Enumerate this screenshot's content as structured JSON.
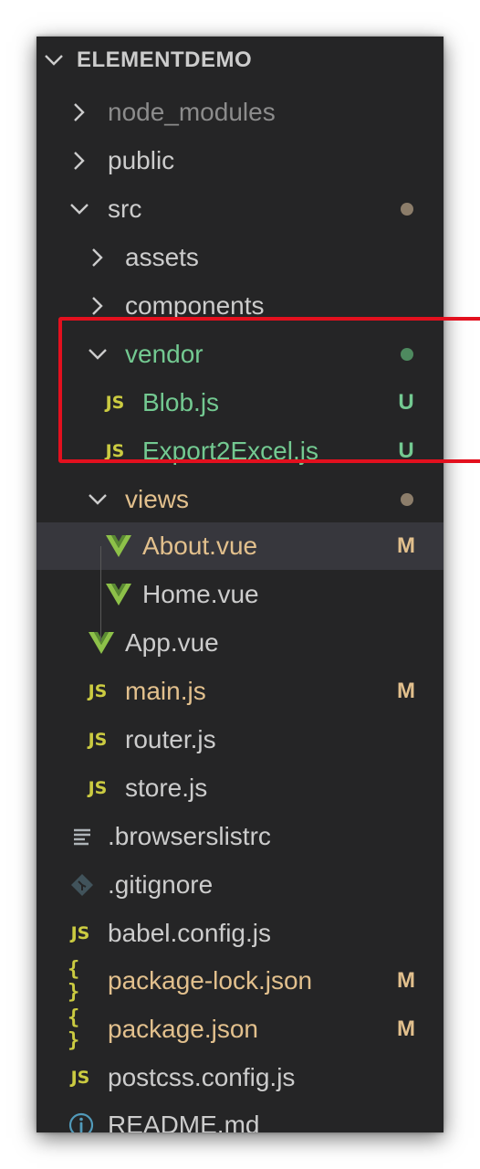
{
  "explorer": {
    "root_title": "ELEMENTDEMO",
    "items": [
      {
        "name": "node_modules",
        "kind": "folder",
        "state": "collapsed",
        "icon": "chevron-right-icon"
      },
      {
        "name": "public",
        "kind": "folder",
        "state": "collapsed",
        "icon": "chevron-right-icon"
      },
      {
        "name": "src",
        "kind": "folder",
        "state": "expanded",
        "icon": "chevron-down-icon"
      },
      {
        "name": "assets",
        "kind": "folder",
        "state": "collapsed",
        "icon": "chevron-right-icon"
      },
      {
        "name": "components",
        "kind": "folder",
        "state": "collapsed",
        "icon": "chevron-right-icon"
      },
      {
        "name": "vendor",
        "kind": "folder",
        "state": "expanded",
        "icon": "chevron-down-icon"
      },
      {
        "name": "Blob.js",
        "kind": "file",
        "icon": "js-icon",
        "icon_text": "JS",
        "badge": "U"
      },
      {
        "name": "Export2Excel.js",
        "kind": "file",
        "icon": "js-icon",
        "icon_text": "JS",
        "badge": "U"
      },
      {
        "name": "views",
        "kind": "folder",
        "state": "expanded",
        "icon": "chevron-down-icon"
      },
      {
        "name": "About.vue",
        "kind": "file",
        "icon": "vue-icon",
        "badge": "M",
        "selected": true
      },
      {
        "name": "Home.vue",
        "kind": "file",
        "icon": "vue-icon"
      },
      {
        "name": "App.vue",
        "kind": "file",
        "icon": "vue-icon"
      },
      {
        "name": "main.js",
        "kind": "file",
        "icon": "js-icon",
        "icon_text": "JS",
        "badge": "M"
      },
      {
        "name": "router.js",
        "kind": "file",
        "icon": "js-icon",
        "icon_text": "JS"
      },
      {
        "name": "store.js",
        "kind": "file",
        "icon": "js-icon",
        "icon_text": "JS"
      },
      {
        "name": ".browserslistrc",
        "kind": "file",
        "icon": "lines-icon"
      },
      {
        "name": ".gitignore",
        "kind": "file",
        "icon": "git-icon"
      },
      {
        "name": "babel.config.js",
        "kind": "file",
        "icon": "js-icon",
        "icon_text": "JS"
      },
      {
        "name": "package-lock.json",
        "kind": "file",
        "icon": "json-icon",
        "icon_text": "{ }",
        "badge": "M"
      },
      {
        "name": "package.json",
        "kind": "file",
        "icon": "json-icon",
        "icon_text": "{ }",
        "badge": "M"
      },
      {
        "name": "postcss.config.js",
        "kind": "file",
        "icon": "js-icon",
        "icon_text": "JS"
      },
      {
        "name": "README.md",
        "kind": "file",
        "icon": "info-icon"
      }
    ]
  },
  "colors": {
    "panel_bg": "#252526",
    "text_default": "#cccccc",
    "text_ignored": "#8c8c8c",
    "text_modified": "#e2c08d",
    "text_untracked": "#73c991",
    "dot_modified": "#8c7d6a",
    "dot_untracked": "#4e8a5f",
    "js_yellow": "#cbcb41",
    "vue_green": "#8dc149",
    "info_blue": "#519aba",
    "git_gray": "#41535b",
    "highlight_red": "#e3101e"
  }
}
